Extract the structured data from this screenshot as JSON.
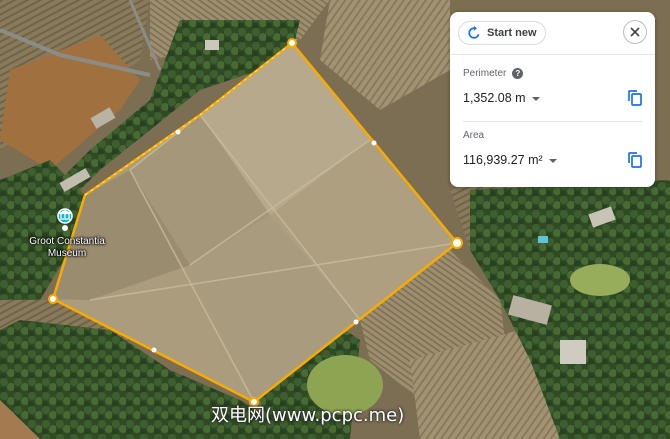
{
  "panel": {
    "start_new_label": "Start new",
    "perimeter_label": "Perimeter",
    "perimeter_value": "1,352.08 m",
    "area_label": "Area",
    "area_value": "116,939.27 m²"
  },
  "map": {
    "poi_name_line1": "Groot Constantia",
    "poi_name_line2": "Museum",
    "poi_icon": "museum-icon",
    "measurement_color": "#f9ab00",
    "field_color": "#9a8b6c",
    "vineyard_color": "#8a7d62"
  },
  "icons": {
    "start_new": "refresh-icon",
    "close": "close-icon",
    "help": "help-icon",
    "copy": "copy-icon"
  },
  "watermark": "双电网(www.pcpc.me)"
}
